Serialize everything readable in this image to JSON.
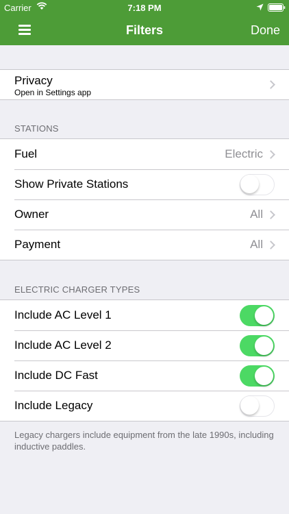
{
  "status_bar": {
    "carrier": "Carrier",
    "time": "7:18 PM",
    "icons": [
      "wifi-icon",
      "location-arrow-icon",
      "battery-icon"
    ]
  },
  "nav_bar": {
    "title": "Filters",
    "done_label": "Done",
    "menu_icon": "hamburger-menu-icon",
    "color": "#4d9c37"
  },
  "privacy": {
    "title": "Privacy",
    "subtitle": "Open in Settings app"
  },
  "stations": {
    "header": "STATIONS",
    "fuel": {
      "label": "Fuel",
      "value": "Electric"
    },
    "show_private": {
      "label": "Show Private Stations",
      "on": false
    },
    "owner": {
      "label": "Owner",
      "value": "All"
    },
    "payment": {
      "label": "Payment",
      "value": "All"
    }
  },
  "charger_types": {
    "header": "ELECTRIC CHARGER TYPES",
    "ac_level_1": {
      "label": "Include AC Level 1",
      "on": true
    },
    "ac_level_2": {
      "label": "Include AC Level 2",
      "on": true
    },
    "dc_fast": {
      "label": "Include DC Fast",
      "on": true
    },
    "legacy": {
      "label": "Include Legacy",
      "on": false
    },
    "footer": "Legacy chargers include equipment from the late 1990s, including inductive paddles."
  },
  "colors": {
    "toggle_on": "#4cd964",
    "background": "#efeff4"
  }
}
